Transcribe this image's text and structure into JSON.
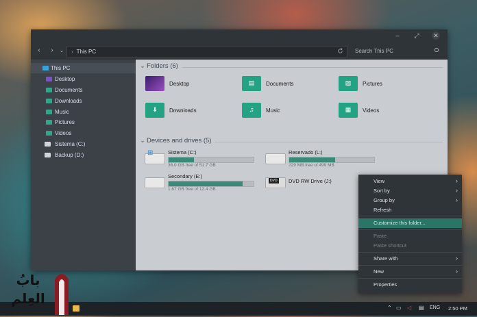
{
  "window": {
    "controls": [
      "–",
      "⤢",
      "✕"
    ],
    "nav": {
      "back": "‹",
      "forward": "›",
      "history": "⌄",
      "separator": "›"
    },
    "path": "This PC",
    "search_placeholder": "Search This PC"
  },
  "sidebar": {
    "items": [
      {
        "label": "This PC",
        "icon": "monitor-icon",
        "color": "#3aa0d8"
      },
      {
        "label": "Desktop",
        "icon": "desktop-icon",
        "color": "#7a55c0"
      },
      {
        "label": "Documents",
        "icon": "documents-icon",
        "color": "#2ea888"
      },
      {
        "label": "Downloads",
        "icon": "downloads-icon",
        "color": "#2ea888"
      },
      {
        "label": "Music",
        "icon": "music-icon",
        "color": "#2ea888"
      },
      {
        "label": "Pictures",
        "icon": "pictures-icon",
        "color": "#2ea888"
      },
      {
        "label": "Videos",
        "icon": "videos-icon",
        "color": "#2ea888"
      },
      {
        "label": "Sistema (C:)",
        "icon": "drive-icon",
        "color": "#cfd4d8"
      },
      {
        "label": "Backup (D:)",
        "icon": "drive-icon",
        "color": "#cfd4d8"
      }
    ]
  },
  "folders_section": {
    "title": "Folders (6)",
    "items": [
      {
        "label": "Desktop",
        "icon": "desktop-icon",
        "glyph": "",
        "color": "#5a3a9a"
      },
      {
        "label": "Documents",
        "icon": "documents-icon",
        "glyph": "▤",
        "color": "#23a284"
      },
      {
        "label": "Pictures",
        "icon": "pictures-icon",
        "glyph": "▨",
        "color": "#23a284"
      },
      {
        "label": "Downloads",
        "icon": "downloads-icon",
        "glyph": "⬇",
        "color": "#23a284"
      },
      {
        "label": "Music",
        "icon": "music-icon",
        "glyph": "♫",
        "color": "#23a284"
      },
      {
        "label": "Videos",
        "icon": "videos-icon",
        "glyph": "▦",
        "color": "#23a284"
      }
    ]
  },
  "drives_section": {
    "title": "Devices and drives (5)",
    "items": [
      {
        "name": "Sistema (C:)",
        "free": "36.0 GB free of 51.7 GB",
        "used_fraction": 0.3,
        "has_bar": true
      },
      {
        "name": "Reservado (L:)",
        "free": "229 MB free of 499 MB",
        "used_fraction": 0.54,
        "has_bar": true
      },
      {
        "name": "Secondary (E:)",
        "free": "1.67 GB free of 12.4 GB",
        "used_fraction": 0.87,
        "has_bar": true
      },
      {
        "name": "DVD RW Drive (J:)",
        "free": "",
        "used_fraction": 0,
        "has_bar": false
      }
    ]
  },
  "context_menu": {
    "items": [
      {
        "label": "View",
        "submenu": true,
        "disabled": false,
        "highlighted": false
      },
      {
        "label": "Sort by",
        "submenu": true,
        "disabled": false,
        "highlighted": false
      },
      {
        "label": "Group by",
        "submenu": true,
        "disabled": false,
        "highlighted": false
      },
      {
        "label": "Refresh",
        "submenu": false,
        "disabled": false,
        "highlighted": false
      },
      {
        "label": "Customize this folder...",
        "submenu": false,
        "disabled": false,
        "highlighted": true
      },
      {
        "label": "Paste",
        "submenu": false,
        "disabled": true,
        "highlighted": false
      },
      {
        "label": "Paste shortcut",
        "submenu": false,
        "disabled": true,
        "highlighted": false
      },
      {
        "label": "Share with",
        "submenu": true,
        "disabled": false,
        "highlighted": false
      },
      {
        "label": "New",
        "submenu": true,
        "disabled": false,
        "highlighted": false
      },
      {
        "label": "Properties",
        "submenu": false,
        "disabled": false,
        "highlighted": false
      }
    ]
  },
  "taskbar": {
    "language": "ENG",
    "time": "2:50 PM"
  },
  "watermark": {
    "text": "بابُ العِلم"
  }
}
